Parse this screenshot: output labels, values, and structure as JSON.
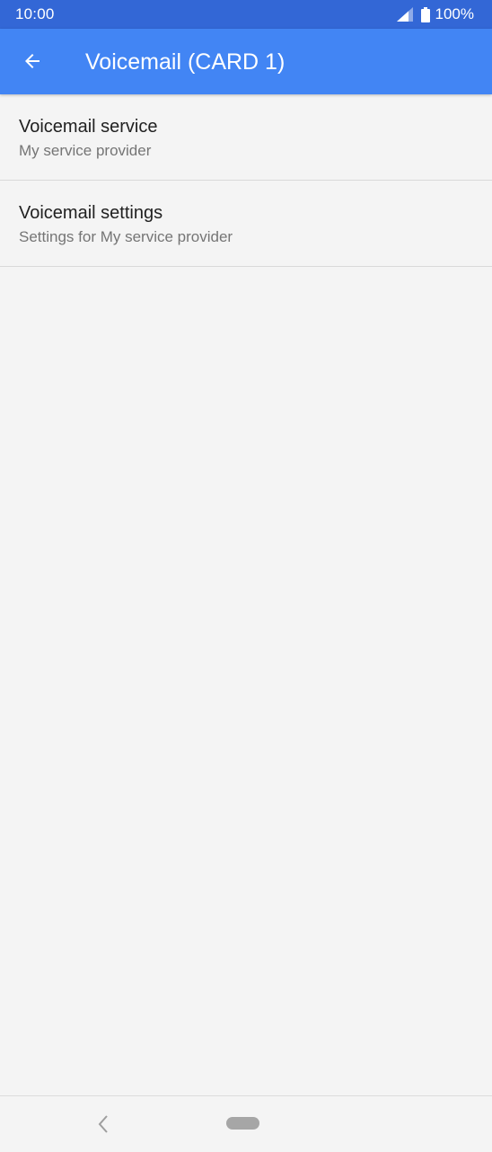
{
  "status_bar": {
    "time": "10:00",
    "battery": "100%",
    "icons": [
      "signal-icon",
      "battery-icon"
    ]
  },
  "app_bar": {
    "back_icon": "arrow-left-icon",
    "title": "Voicemail (CARD 1)",
    "color": "#4285f4"
  },
  "settings": {
    "items": [
      {
        "title": "Voicemail service",
        "summary": "My service provider"
      },
      {
        "title": "Voicemail settings",
        "summary": "Settings for My service provider"
      }
    ]
  },
  "nav_bar": {
    "icons": [
      "nav-back-icon",
      "nav-home-pill"
    ]
  }
}
